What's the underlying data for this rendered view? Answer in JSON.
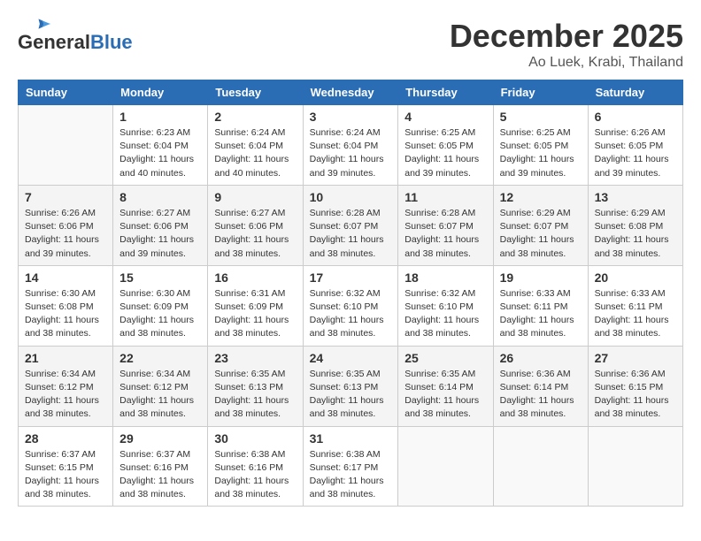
{
  "header": {
    "logo_general": "General",
    "logo_blue": "Blue",
    "month": "December 2025",
    "location": "Ao Luek, Krabi, Thailand"
  },
  "weekdays": [
    "Sunday",
    "Monday",
    "Tuesday",
    "Wednesday",
    "Thursday",
    "Friday",
    "Saturday"
  ],
  "weeks": [
    [
      {
        "day": "",
        "sunrise": "",
        "sunset": "",
        "daylight": "",
        "empty": true
      },
      {
        "day": "1",
        "sunrise": "Sunrise: 6:23 AM",
        "sunset": "Sunset: 6:04 PM",
        "daylight": "Daylight: 11 hours and 40 minutes."
      },
      {
        "day": "2",
        "sunrise": "Sunrise: 6:24 AM",
        "sunset": "Sunset: 6:04 PM",
        "daylight": "Daylight: 11 hours and 40 minutes."
      },
      {
        "day": "3",
        "sunrise": "Sunrise: 6:24 AM",
        "sunset": "Sunset: 6:04 PM",
        "daylight": "Daylight: 11 hours and 39 minutes."
      },
      {
        "day": "4",
        "sunrise": "Sunrise: 6:25 AM",
        "sunset": "Sunset: 6:05 PM",
        "daylight": "Daylight: 11 hours and 39 minutes."
      },
      {
        "day": "5",
        "sunrise": "Sunrise: 6:25 AM",
        "sunset": "Sunset: 6:05 PM",
        "daylight": "Daylight: 11 hours and 39 minutes."
      },
      {
        "day": "6",
        "sunrise": "Sunrise: 6:26 AM",
        "sunset": "Sunset: 6:05 PM",
        "daylight": "Daylight: 11 hours and 39 minutes."
      }
    ],
    [
      {
        "day": "7",
        "sunrise": "Sunrise: 6:26 AM",
        "sunset": "Sunset: 6:06 PM",
        "daylight": "Daylight: 11 hours and 39 minutes."
      },
      {
        "day": "8",
        "sunrise": "Sunrise: 6:27 AM",
        "sunset": "Sunset: 6:06 PM",
        "daylight": "Daylight: 11 hours and 39 minutes."
      },
      {
        "day": "9",
        "sunrise": "Sunrise: 6:27 AM",
        "sunset": "Sunset: 6:06 PM",
        "daylight": "Daylight: 11 hours and 38 minutes."
      },
      {
        "day": "10",
        "sunrise": "Sunrise: 6:28 AM",
        "sunset": "Sunset: 6:07 PM",
        "daylight": "Daylight: 11 hours and 38 minutes."
      },
      {
        "day": "11",
        "sunrise": "Sunrise: 6:28 AM",
        "sunset": "Sunset: 6:07 PM",
        "daylight": "Daylight: 11 hours and 38 minutes."
      },
      {
        "day": "12",
        "sunrise": "Sunrise: 6:29 AM",
        "sunset": "Sunset: 6:07 PM",
        "daylight": "Daylight: 11 hours and 38 minutes."
      },
      {
        "day": "13",
        "sunrise": "Sunrise: 6:29 AM",
        "sunset": "Sunset: 6:08 PM",
        "daylight": "Daylight: 11 hours and 38 minutes."
      }
    ],
    [
      {
        "day": "14",
        "sunrise": "Sunrise: 6:30 AM",
        "sunset": "Sunset: 6:08 PM",
        "daylight": "Daylight: 11 hours and 38 minutes."
      },
      {
        "day": "15",
        "sunrise": "Sunrise: 6:30 AM",
        "sunset": "Sunset: 6:09 PM",
        "daylight": "Daylight: 11 hours and 38 minutes."
      },
      {
        "day": "16",
        "sunrise": "Sunrise: 6:31 AM",
        "sunset": "Sunset: 6:09 PM",
        "daylight": "Daylight: 11 hours and 38 minutes."
      },
      {
        "day": "17",
        "sunrise": "Sunrise: 6:32 AM",
        "sunset": "Sunset: 6:10 PM",
        "daylight": "Daylight: 11 hours and 38 minutes."
      },
      {
        "day": "18",
        "sunrise": "Sunrise: 6:32 AM",
        "sunset": "Sunset: 6:10 PM",
        "daylight": "Daylight: 11 hours and 38 minutes."
      },
      {
        "day": "19",
        "sunrise": "Sunrise: 6:33 AM",
        "sunset": "Sunset: 6:11 PM",
        "daylight": "Daylight: 11 hours and 38 minutes."
      },
      {
        "day": "20",
        "sunrise": "Sunrise: 6:33 AM",
        "sunset": "Sunset: 6:11 PM",
        "daylight": "Daylight: 11 hours and 38 minutes."
      }
    ],
    [
      {
        "day": "21",
        "sunrise": "Sunrise: 6:34 AM",
        "sunset": "Sunset: 6:12 PM",
        "daylight": "Daylight: 11 hours and 38 minutes."
      },
      {
        "day": "22",
        "sunrise": "Sunrise: 6:34 AM",
        "sunset": "Sunset: 6:12 PM",
        "daylight": "Daylight: 11 hours and 38 minutes."
      },
      {
        "day": "23",
        "sunrise": "Sunrise: 6:35 AM",
        "sunset": "Sunset: 6:13 PM",
        "daylight": "Daylight: 11 hours and 38 minutes."
      },
      {
        "day": "24",
        "sunrise": "Sunrise: 6:35 AM",
        "sunset": "Sunset: 6:13 PM",
        "daylight": "Daylight: 11 hours and 38 minutes."
      },
      {
        "day": "25",
        "sunrise": "Sunrise: 6:35 AM",
        "sunset": "Sunset: 6:14 PM",
        "daylight": "Daylight: 11 hours and 38 minutes."
      },
      {
        "day": "26",
        "sunrise": "Sunrise: 6:36 AM",
        "sunset": "Sunset: 6:14 PM",
        "daylight": "Daylight: 11 hours and 38 minutes."
      },
      {
        "day": "27",
        "sunrise": "Sunrise: 6:36 AM",
        "sunset": "Sunset: 6:15 PM",
        "daylight": "Daylight: 11 hours and 38 minutes."
      }
    ],
    [
      {
        "day": "28",
        "sunrise": "Sunrise: 6:37 AM",
        "sunset": "Sunset: 6:15 PM",
        "daylight": "Daylight: 11 hours and 38 minutes."
      },
      {
        "day": "29",
        "sunrise": "Sunrise: 6:37 AM",
        "sunset": "Sunset: 6:16 PM",
        "daylight": "Daylight: 11 hours and 38 minutes."
      },
      {
        "day": "30",
        "sunrise": "Sunrise: 6:38 AM",
        "sunset": "Sunset: 6:16 PM",
        "daylight": "Daylight: 11 hours and 38 minutes."
      },
      {
        "day": "31",
        "sunrise": "Sunrise: 6:38 AM",
        "sunset": "Sunset: 6:17 PM",
        "daylight": "Daylight: 11 hours and 38 minutes."
      },
      {
        "day": "",
        "sunrise": "",
        "sunset": "",
        "daylight": "",
        "empty": true
      },
      {
        "day": "",
        "sunrise": "",
        "sunset": "",
        "daylight": "",
        "empty": true
      },
      {
        "day": "",
        "sunrise": "",
        "sunset": "",
        "daylight": "",
        "empty": true
      }
    ]
  ]
}
